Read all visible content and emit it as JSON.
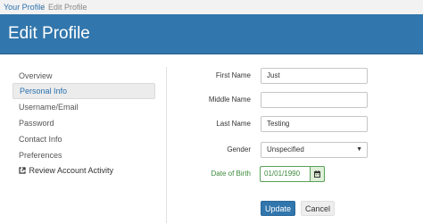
{
  "breadcrumb": {
    "link": "Your Profile",
    "separator": "/",
    "current": "Edit Profile"
  },
  "header": {
    "title": "Edit Profile"
  },
  "sidebar": {
    "items": [
      {
        "label": "Overview"
      },
      {
        "label": "Personal Info"
      },
      {
        "label": "Username/Email"
      },
      {
        "label": "Password"
      },
      {
        "label": "Contact Info"
      },
      {
        "label": "Preferences"
      },
      {
        "label": "Review Account Activity",
        "icon": "external-link-icon"
      }
    ],
    "active": "Personal Info"
  },
  "form": {
    "first_name": {
      "label": "First Name",
      "value": "Just"
    },
    "middle_name": {
      "label": "Middle Name",
      "value": ""
    },
    "last_name": {
      "label": "Last Name",
      "value": "Testing"
    },
    "gender": {
      "label": "Gender",
      "value": "Unspecified"
    },
    "dob": {
      "label": "Date of Birth",
      "value": "01/01/1990",
      "icon": "calendar-icon"
    }
  },
  "buttons": {
    "update": "Update",
    "cancel": "Cancel"
  },
  "colors": {
    "header_bg": "#3176ac",
    "link": "#2a70ae",
    "dob_green": "#3c8a3c"
  }
}
